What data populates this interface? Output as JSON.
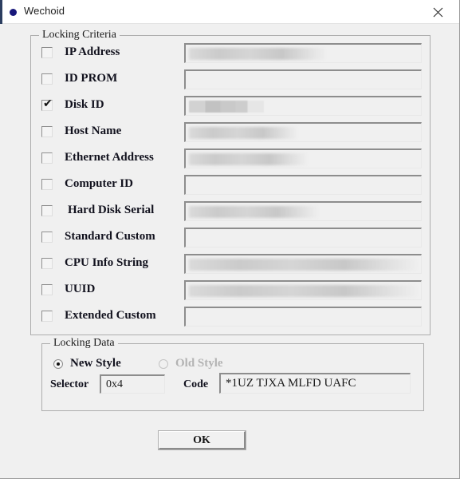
{
  "window": {
    "title": "Wechoid",
    "app_icon": "blue-dot-icon",
    "close_icon": "close-icon"
  },
  "criteria_group": {
    "title": "Locking Criteria",
    "rows": [
      {
        "label": "IP Address",
        "checked": false,
        "redact": 58
      },
      {
        "label": "ID PROM",
        "checked": false,
        "redact": 0
      },
      {
        "label": "Disk ID",
        "checked": true,
        "redact": 32,
        "style": "blocky"
      },
      {
        "label": "Host Name",
        "checked": false,
        "redact": 46
      },
      {
        "label": "Ethernet Address",
        "checked": false,
        "redact": 50
      },
      {
        "label": "Computer ID",
        "checked": false,
        "redact": 0
      },
      {
        "label": "Hard Disk Serial",
        "checked": false,
        "redact": 55,
        "indent": true
      },
      {
        "label": "Standard Custom",
        "checked": false,
        "redact": 0
      },
      {
        "label": "CPU Info String",
        "checked": false,
        "redact": 97
      },
      {
        "label": "UUID",
        "checked": false,
        "redact": 97
      },
      {
        "label": "Extended Custom",
        "checked": false,
        "redact": 0
      }
    ]
  },
  "locking_data": {
    "title": "Locking Data",
    "new_style_label": "New Style",
    "new_style_selected": true,
    "old_style_label": "Old Style",
    "old_style_selected": false,
    "old_style_disabled": true,
    "selector_label": "Selector",
    "selector_value": "0x4",
    "code_label": "Code",
    "code_value": "*1UZ TJXA MLFD UAFC"
  },
  "ok_button": {
    "label": "OK"
  },
  "colors": {
    "window_bg": "#f0f0f0",
    "titlebar_bg": "#ffffff",
    "accent": "#17177a",
    "text": "#12121e",
    "disabled_text": "#b3b3b3",
    "border": "#adadad"
  }
}
